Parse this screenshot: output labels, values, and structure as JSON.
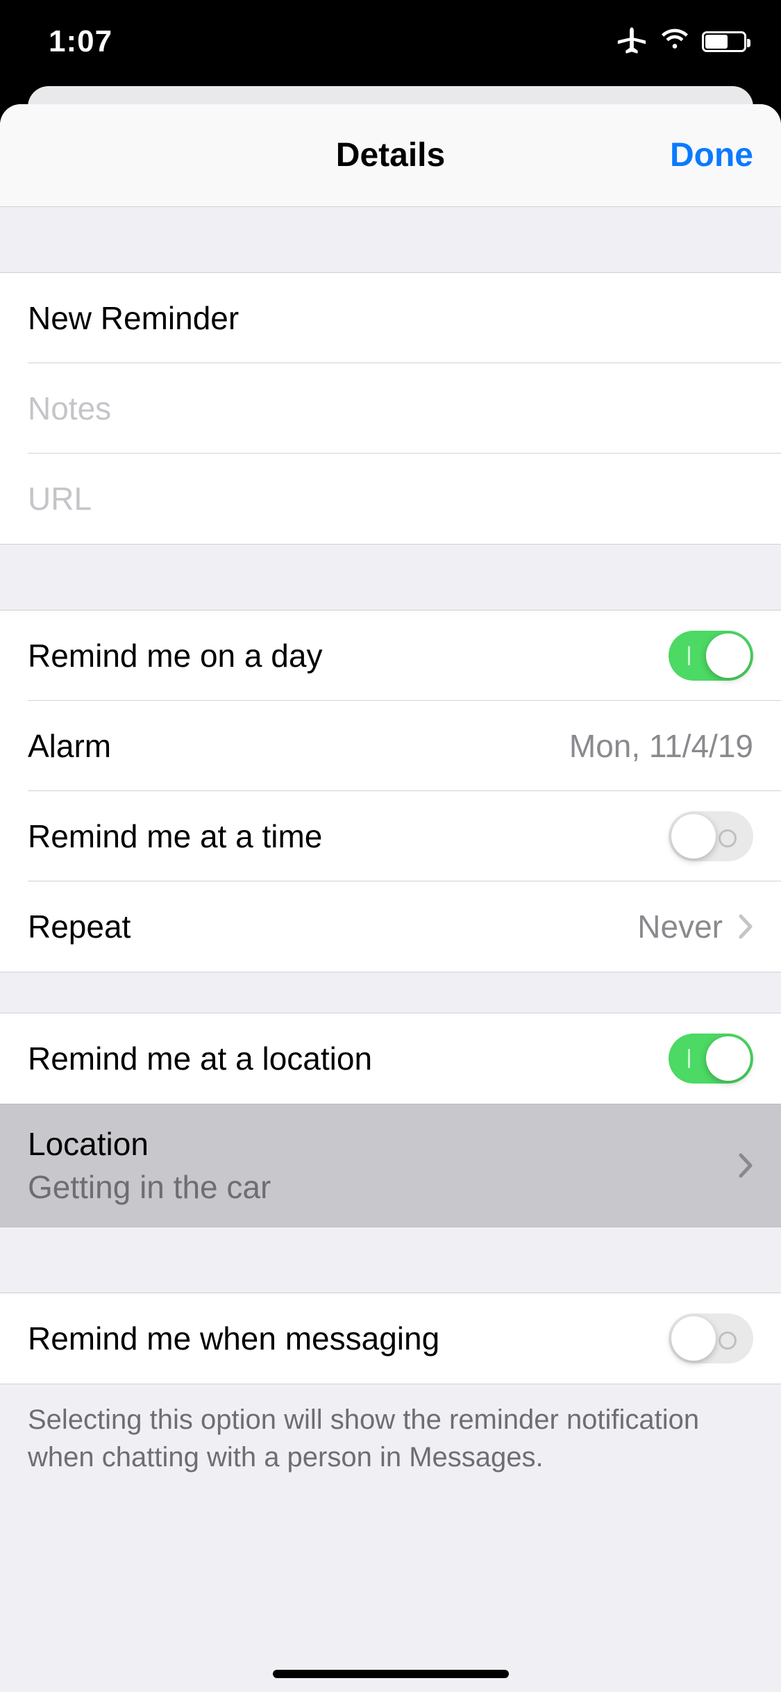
{
  "statusbar": {
    "time": "1:07"
  },
  "modal": {
    "title": "Details",
    "done_label": "Done"
  },
  "fields": {
    "title_value": "New Reminder",
    "notes_placeholder": "Notes",
    "url_placeholder": "URL"
  },
  "rows": {
    "remind_day_label": "Remind me on a day",
    "remind_day_on": true,
    "alarm_label": "Alarm",
    "alarm_value": "Mon, 11/4/19",
    "remind_time_label": "Remind me at a time",
    "remind_time_on": false,
    "repeat_label": "Repeat",
    "repeat_value": "Never",
    "remind_location_label": "Remind me at a location",
    "remind_location_on": true,
    "location_label": "Location",
    "location_value": "Getting in the car",
    "remind_messaging_label": "Remind me when messaging",
    "remind_messaging_on": false
  },
  "footer": {
    "messaging_note": "Selecting this option will show the reminder notification when chatting with a person in Messages."
  }
}
